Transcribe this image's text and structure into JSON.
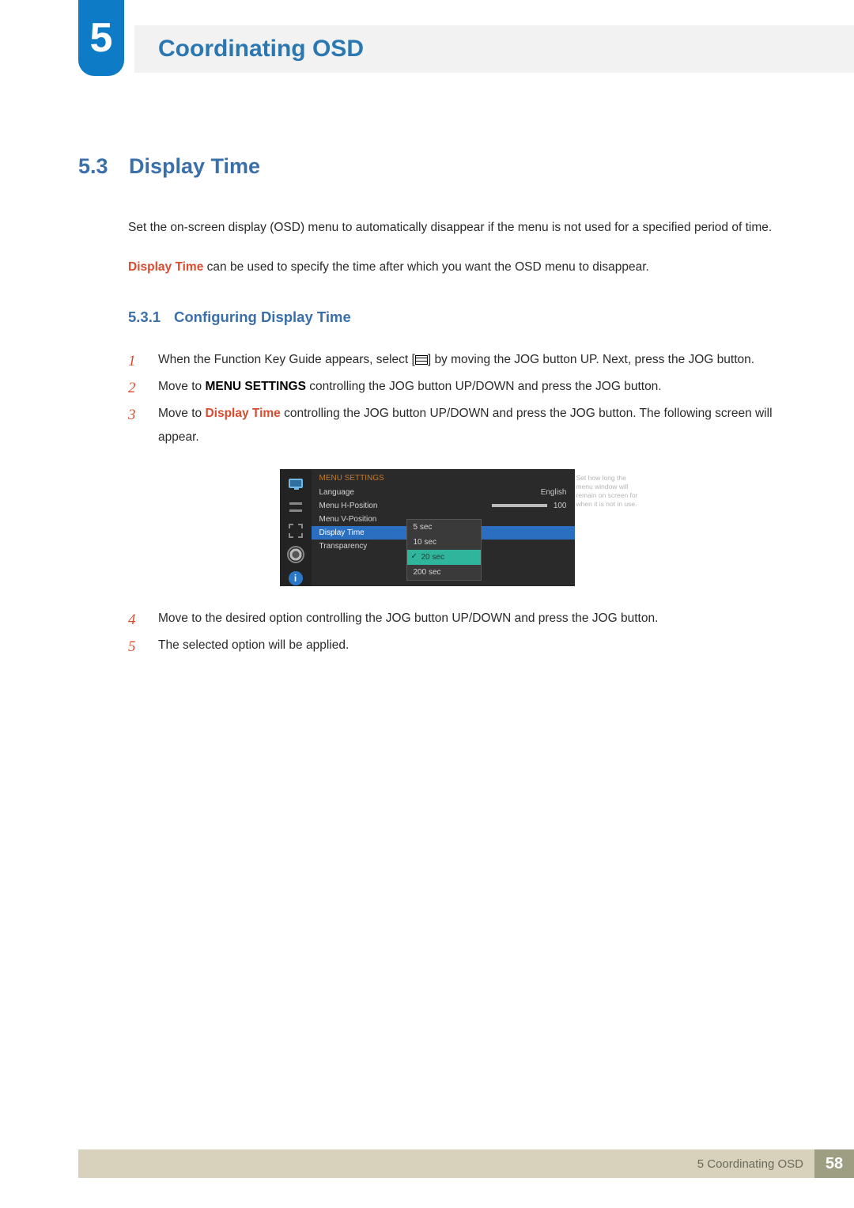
{
  "chapter": {
    "number": "5",
    "title": "Coordinating OSD"
  },
  "section": {
    "number": "5.3",
    "title": "Display Time",
    "intro1": "Set the on-screen display (OSD) menu to automatically disappear if the menu is not used for a specified period of time.",
    "emph_name": "Display Time",
    "intro2_rest": " can be used to specify the time after which you want the OSD menu to disappear."
  },
  "subsection": {
    "number": "5.3.1",
    "title": "Configuring Display Time"
  },
  "steps": {
    "s1": {
      "n": "1",
      "pre": "When the Function Key Guide appears, select [",
      "post": "] by moving the JOG button UP. Next, press the JOG button."
    },
    "s2": {
      "n": "2",
      "pre": "Move to ",
      "bold": "MENU SETTINGS",
      "post": " controlling the JOG button UP/DOWN and press the JOG button."
    },
    "s3": {
      "n": "3",
      "pre": "Move to ",
      "emph": "Display Time",
      "post": " controlling the JOG button UP/DOWN and press the JOG button. The following screen will appear."
    },
    "s4": {
      "n": "4",
      "text": "Move to the desired option controlling the JOG button UP/DOWN and press the JOG button."
    },
    "s5": {
      "n": "5",
      "text": "The selected option will be applied."
    }
  },
  "osd": {
    "title": "MENU SETTINGS",
    "rows": {
      "language": {
        "label": "Language",
        "value": "English"
      },
      "menu_h": {
        "label": "Menu H-Position",
        "value": "100"
      },
      "menu_v": {
        "label": "Menu V-Position"
      },
      "display_time": {
        "label": "Display Time"
      },
      "transparency": {
        "label": "Transparency"
      }
    },
    "dropdown": {
      "o1": "5 sec",
      "o2": "10 sec",
      "o3": "20 sec",
      "o4": "200 sec"
    },
    "help": "Set how long the menu window will remain on screen for when it is not in use."
  },
  "footer": {
    "text": "5 Coordinating OSD",
    "page": "58"
  }
}
